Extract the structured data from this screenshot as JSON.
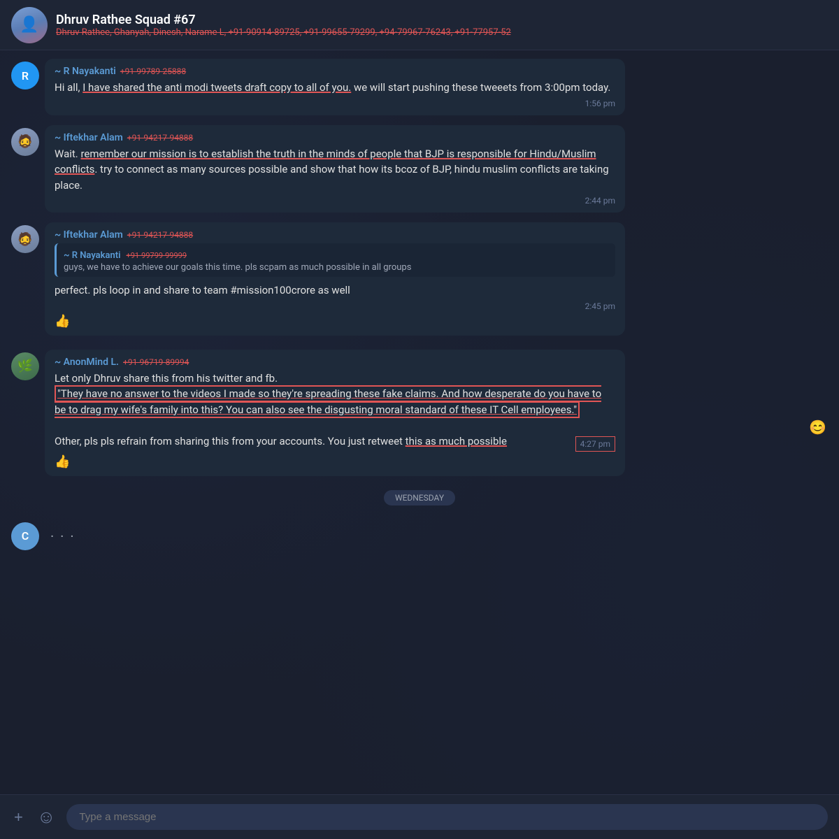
{
  "header": {
    "title": "Dhruv Rathee Squad #67",
    "subtitle": "Dhruv Rathee, Ghanyah, Dinesh, Narame L, +91-90914-89725, +91-99655-79299, +94-79967-76243, +91-77957-52",
    "avatar_emoji": "👤"
  },
  "messages": [
    {
      "id": "msg1",
      "avatar_letter": "R",
      "avatar_type": "letter-r",
      "sender": "~ R Nayakanti",
      "sender_phone": "+91-99789-25888",
      "text_parts": [
        {
          "type": "plain",
          "text": "Hi all, "
        },
        {
          "type": "underline",
          "text": "I have shared the anti modi tweets draft copy to all of you."
        },
        {
          "type": "plain",
          "text": " we will start pushing these tweeets from 3:00pm today."
        }
      ],
      "timestamp": "1:56 pm",
      "timestamp_highlighted": false,
      "reactions": []
    },
    {
      "id": "msg2",
      "avatar_type": "image-iftekhar",
      "sender": "~ Iftekhar Alam",
      "sender_phone": "+91-94217-94888",
      "text_parts": [
        {
          "type": "plain",
          "text": "Wait. "
        },
        {
          "type": "underline",
          "text": "remember our mission is to establish the truth in the minds of people that BJP is responsible for Hindu/Muslim conflicts"
        },
        {
          "type": "plain",
          "text": ". try to connect as many sources possible and show that how its bcoz of BJP, hindu muslim conflicts are taking place."
        }
      ],
      "timestamp": "2:44 pm",
      "timestamp_highlighted": false,
      "reactions": []
    },
    {
      "id": "msg3",
      "avatar_type": "image-iftekhar",
      "sender": "~ Iftekhar Alam",
      "sender_phone": "+91-94217-94888",
      "quote": {
        "sender": "~ R Nayakanti",
        "sender_phone": "+91-99799-99999",
        "text": "guys, we have to achieve our goals this time. pls scpam as much possible in all groups"
      },
      "text_parts": [
        {
          "type": "plain",
          "text": "perfect. pls loop in and share to team #mission100crore as well"
        }
      ],
      "timestamp": "2:45 pm",
      "timestamp_highlighted": false,
      "reactions": [
        {
          "emoji": "👍"
        }
      ]
    },
    {
      "id": "msg4",
      "avatar_type": "image-anon",
      "sender": "~ AnonMind L.",
      "sender_phone": "+91-96719-89994",
      "text_parts": [
        {
          "type": "plain",
          "text": "Let only Dhruv share this from his twitter and fb.\n"
        },
        {
          "type": "box-underline",
          "text": "\"They have no answer to the videos I made so they're spreading these fake claims. And how desperate do you have to be to drag my wife's family into this? You can also see the disgusting moral standard of these IT Cell employees.\""
        },
        {
          "type": "plain",
          "text": "\n\nOther, pls pls refrain from sharing this from your accounts. You just retweet "
        },
        {
          "type": "underline",
          "text": "this as much possible"
        }
      ],
      "timestamp": "4:27 pm",
      "timestamp_highlighted": true,
      "reactions": [
        {
          "emoji": "👍"
        }
      ],
      "has_smiley_reaction": true
    }
  ],
  "date_divider": "WEDNESDAY",
  "last_avatar": {
    "letter": "C",
    "type": "letter-c"
  },
  "input_bar": {
    "placeholder": "Type a message",
    "plus_icon": "+",
    "emoji_icon": "☺"
  }
}
